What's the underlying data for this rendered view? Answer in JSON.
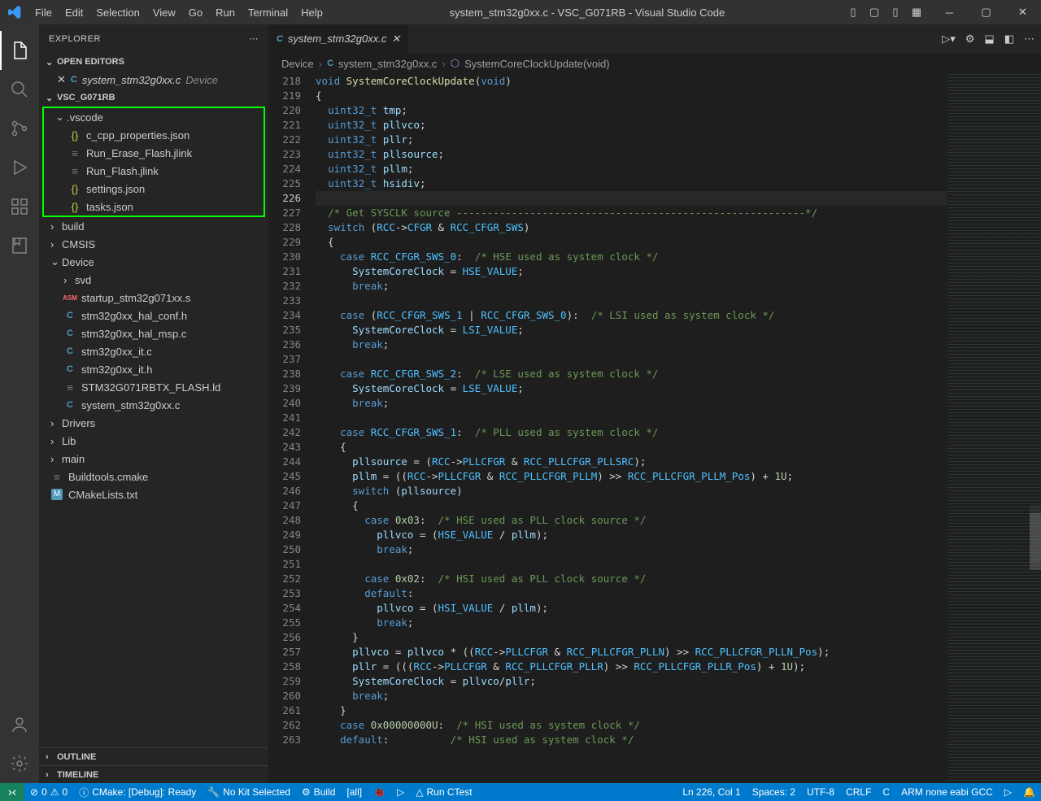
{
  "window": {
    "title": "system_stm32g0xx.c - VSC_G071RB - Visual Studio Code"
  },
  "menu": [
    "File",
    "Edit",
    "Selection",
    "View",
    "Go",
    "Run",
    "Terminal",
    "Help"
  ],
  "explorer": {
    "title": "EXPLORER",
    "openEditors": {
      "title": "OPEN EDITORS",
      "items": [
        {
          "icon": "C",
          "name": "system_stm32g0xx.c",
          "hint": "Device"
        }
      ]
    },
    "project": "VSC_G071RB",
    "tree": {
      "vscode": {
        "label": ".vscode",
        "children": [
          {
            "icon": "json",
            "name": "c_cpp_properties.json"
          },
          {
            "icon": "lines",
            "name": "Run_Erase_Flash.jlink"
          },
          {
            "icon": "lines",
            "name": "Run_Flash.jlink"
          },
          {
            "icon": "json",
            "name": "settings.json"
          },
          {
            "icon": "json",
            "name": "tasks.json"
          }
        ]
      },
      "folders": [
        {
          "label": "build"
        },
        {
          "label": "CMSIS"
        }
      ],
      "device": {
        "label": "Device",
        "children": [
          {
            "label": "svd",
            "folder": true
          },
          {
            "icon": "asm",
            "name": "startup_stm32g071xx.s"
          },
          {
            "icon": "C",
            "name": "stm32g0xx_hal_conf.h"
          },
          {
            "icon": "C",
            "name": "stm32g0xx_hal_msp.c"
          },
          {
            "icon": "C",
            "name": "stm32g0xx_it.c"
          },
          {
            "icon": "C",
            "name": "stm32g0xx_it.h"
          },
          {
            "icon": "lines",
            "name": "STM32G071RBTX_FLASH.ld"
          },
          {
            "icon": "C",
            "name": "system_stm32g0xx.c"
          }
        ]
      },
      "after": [
        {
          "label": "Drivers"
        },
        {
          "label": "Lib"
        },
        {
          "label": "main"
        },
        {
          "icon": "lines",
          "name": "Buildtools.cmake"
        },
        {
          "icon": "M",
          "name": "CMakeLists.txt"
        }
      ]
    },
    "outline": "OUTLINE",
    "timeline": "TIMELINE"
  },
  "tab": {
    "icon": "C",
    "name": "system_stm32g0xx.c"
  },
  "breadcrumbs": {
    "seg1": "Device",
    "seg2": "system_stm32g0xx.c",
    "seg3": "SystemCoreClockUpdate(void)"
  },
  "code": {
    "start": 218,
    "lines": [
      {
        "n": 218,
        "h": "<span class='kw'>void</span> <span class='fn'>SystemCoreClockUpdate</span>(<span class='kw'>void</span>)"
      },
      {
        "n": 219,
        "h": "<span class='op'>{</span>"
      },
      {
        "n": 220,
        "h": "  <span class='type'>uint32_t</span> <span class='var'>tmp</span>;"
      },
      {
        "n": 221,
        "h": "  <span class='type'>uint32_t</span> <span class='var'>pllvco</span>;"
      },
      {
        "n": 222,
        "h": "  <span class='type'>uint32_t</span> <span class='var'>pllr</span>;"
      },
      {
        "n": 223,
        "h": "  <span class='type'>uint32_t</span> <span class='var'>pllsource</span>;"
      },
      {
        "n": 224,
        "h": "  <span class='type'>uint32_t</span> <span class='var'>pllm</span>;"
      },
      {
        "n": 225,
        "h": "  <span class='type'>uint32_t</span> <span class='var'>hsidiv</span>;"
      },
      {
        "n": 226,
        "h": "",
        "current": true
      },
      {
        "n": 227,
        "h": "  <span class='cmt'>/* Get SYSCLK source ---------------------------------------------------------*/</span>"
      },
      {
        "n": 228,
        "h": "  <span class='kw'>switch</span> (<span class='const'>RCC</span>-&gt;<span class='const'>CFGR</span> &amp; <span class='const'>RCC_CFGR_SWS</span>)"
      },
      {
        "n": 229,
        "h": "  {"
      },
      {
        "n": 230,
        "h": "    <span class='kw'>case</span> <span class='const'>RCC_CFGR_SWS_0</span>:  <span class='cmt'>/* HSE used as system clock */</span>"
      },
      {
        "n": 231,
        "h": "      <span class='var'>SystemCoreClock</span> = <span class='const'>HSE_VALUE</span>;"
      },
      {
        "n": 232,
        "h": "      <span class='kw'>break</span>;"
      },
      {
        "n": 233,
        "h": ""
      },
      {
        "n": 234,
        "h": "    <span class='kw'>case</span> (<span class='const'>RCC_CFGR_SWS_1</span> | <span class='const'>RCC_CFGR_SWS_0</span>):  <span class='cmt'>/* LSI used as system clock */</span>"
      },
      {
        "n": 235,
        "h": "      <span class='var'>SystemCoreClock</span> = <span class='const'>LSI_VALUE</span>;"
      },
      {
        "n": 236,
        "h": "      <span class='kw'>break</span>;"
      },
      {
        "n": 237,
        "h": ""
      },
      {
        "n": 238,
        "h": "    <span class='kw'>case</span> <span class='const'>RCC_CFGR_SWS_2</span>:  <span class='cmt'>/* LSE used as system clock */</span>"
      },
      {
        "n": 239,
        "h": "      <span class='var'>SystemCoreClock</span> = <span class='const'>LSE_VALUE</span>;"
      },
      {
        "n": 240,
        "h": "      <span class='kw'>break</span>;"
      },
      {
        "n": 241,
        "h": ""
      },
      {
        "n": 242,
        "h": "    <span class='kw'>case</span> <span class='const'>RCC_CFGR_SWS_1</span>:  <span class='cmt'>/* PLL used as system clock */</span>"
      },
      {
        "n": 243,
        "h": "    {"
      },
      {
        "n": 244,
        "h": "      <span class='var'>pllsource</span> = (<span class='const'>RCC</span>-&gt;<span class='const'>PLLCFGR</span> &amp; <span class='const'>RCC_PLLCFGR_PLLSRC</span>);"
      },
      {
        "n": 245,
        "h": "      <span class='var'>pllm</span> = ((<span class='const'>RCC</span>-&gt;<span class='const'>PLLCFGR</span> &amp; <span class='const'>RCC_PLLCFGR_PLLM</span>) &gt;&gt; <span class='const'>RCC_PLLCFGR_PLLM_Pos</span>) + <span class='num'>1U</span>;"
      },
      {
        "n": 246,
        "h": "      <span class='kw'>switch</span> (<span class='var'>pllsource</span>)"
      },
      {
        "n": 247,
        "h": "      {"
      },
      {
        "n": 248,
        "h": "        <span class='kw'>case</span> <span class='num'>0x03</span>:  <span class='cmt'>/* HSE used as PLL clock source */</span>"
      },
      {
        "n": 249,
        "h": "          <span class='var'>pllvco</span> = (<span class='const'>HSE_VALUE</span> / <span class='var'>pllm</span>);"
      },
      {
        "n": 250,
        "h": "          <span class='kw'>break</span>;"
      },
      {
        "n": 251,
        "h": ""
      },
      {
        "n": 252,
        "h": "        <span class='kw'>case</span> <span class='num'>0x02</span>:  <span class='cmt'>/* HSI used as PLL clock source */</span>"
      },
      {
        "n": 253,
        "h": "        <span class='kw'>default</span>:"
      },
      {
        "n": 254,
        "h": "          <span class='var'>pllvco</span> = (<span class='const'>HSI_VALUE</span> / <span class='var'>pllm</span>);"
      },
      {
        "n": 255,
        "h": "          <span class='kw'>break</span>;"
      },
      {
        "n": 256,
        "h": "      }"
      },
      {
        "n": 257,
        "h": "      <span class='var'>pllvco</span> = <span class='var'>pllvco</span> * ((<span class='const'>RCC</span>-&gt;<span class='const'>PLLCFGR</span> &amp; <span class='const'>RCC_PLLCFGR_PLLN</span>) &gt;&gt; <span class='const'>RCC_PLLCFGR_PLLN_Pos</span>);"
      },
      {
        "n": 258,
        "h": "      <span class='var'>pllr</span> = (((<span class='const'>RCC</span>-&gt;<span class='const'>PLLCFGR</span> &amp; <span class='const'>RCC_PLLCFGR_PLLR</span>) &gt;&gt; <span class='const'>RCC_PLLCFGR_PLLR_Pos</span>) + <span class='num'>1U</span>);"
      },
      {
        "n": 259,
        "h": "      <span class='var'>SystemCoreClock</span> = <span class='var'>pllvco</span>/<span class='var'>pllr</span>;"
      },
      {
        "n": 260,
        "h": "      <span class='kw'>break</span>;"
      },
      {
        "n": 261,
        "h": "    }"
      },
      {
        "n": 262,
        "h": "    <span class='kw'>case</span> <span class='num'>0x00000000U</span>:  <span class='cmt'>/* HSI used as system clock */</span>"
      },
      {
        "n": 263,
        "h": "    <span class='kw'>default</span>:          <span class='cmt'>/* HSI used as system clock */</span>"
      }
    ]
  },
  "status": {
    "errors": "0",
    "warnings": "0",
    "cmake": "CMake: [Debug]: Ready",
    "kit": "No Kit Selected",
    "build": "Build",
    "target": "[all]",
    "ctest": "Run CTest",
    "pos": "Ln 226, Col 1",
    "spaces": "Spaces: 2",
    "enc": "UTF-8",
    "eol": "CRLF",
    "lang": "C",
    "compiler": "ARM none eabi GCC"
  }
}
